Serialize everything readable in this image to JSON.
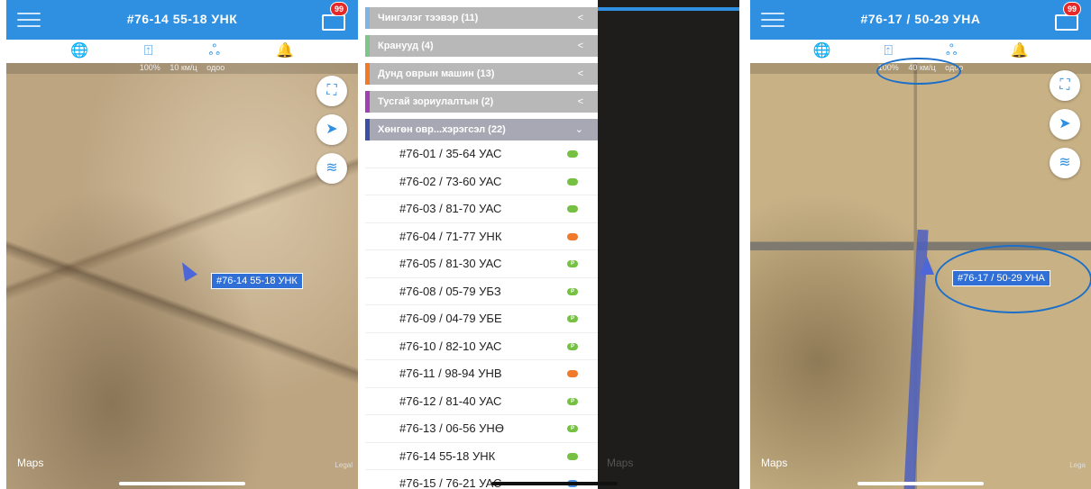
{
  "colors": {
    "accent": "#2f8fe0",
    "status_green": "#76c043",
    "status_orange": "#f07a2a",
    "status_blue": "#4a90e2",
    "status_parked": "#76c043"
  },
  "screen1": {
    "title": "#76-14 55-18 УНК",
    "badge": "99",
    "info": {
      "battery": "100%",
      "speed": "10 км/ц",
      "time": "одоо"
    },
    "vehicle_label": "#76-14 55-18 УНК",
    "maps_text": "Maps",
    "legal_text": "Legal"
  },
  "screen2": {
    "categories": [
      {
        "label": "Чингэлэг тээвэр (11)",
        "color": "#7fb5e6",
        "chevron": "<"
      },
      {
        "label": "Кранууд (4)",
        "color": "#7ec58a",
        "chevron": "<"
      },
      {
        "label": "Дунд оврын машин (13)",
        "color": "#f07a2a",
        "chevron": "<"
      },
      {
        "label": "Тусгай зориулалтын (2)",
        "color": "#a23fb4",
        "chevron": "<"
      }
    ],
    "open_category": {
      "label": "Хөнгөн овр...хэрэгсэл (22)",
      "color": "#3b4fa6",
      "chevron": "⌄"
    },
    "vehicles": [
      {
        "name": "#76-01 / 35-64 УАС",
        "status": "green"
      },
      {
        "name": "#76-02 / 73-60 УАС",
        "status": "green"
      },
      {
        "name": "#76-03 / 81-70 УАС",
        "status": "green"
      },
      {
        "name": "#76-04 / 71-77 УНК",
        "status": "orange"
      },
      {
        "name": "#76-05 / 81-30 УАС",
        "status": "parked"
      },
      {
        "name": "#76-08 / 05-79 УБЗ",
        "status": "parked"
      },
      {
        "name": "#76-09 / 04-79 УБЕ",
        "status": "parked"
      },
      {
        "name": "#76-10 / 82-10 УАС",
        "status": "parked"
      },
      {
        "name": "#76-11 / 98-94 УНВ",
        "status": "orange"
      },
      {
        "name": "#76-12 / 81-40 УАС",
        "status": "parked"
      },
      {
        "name": "#76-13 / 06-56 УНӨ",
        "status": "parked"
      },
      {
        "name": "#76-14 55-18 УНК",
        "status": "green"
      },
      {
        "name": "#76-15 / 76-21 УАС",
        "status": "blue"
      }
    ],
    "maps_text": "Maps"
  },
  "screen3": {
    "title": "#76-17 / 50-29 УНА",
    "badge": "99",
    "info": {
      "battery": "100%",
      "speed": "40 км/ц",
      "time": "одоо"
    },
    "vehicle_label": "#76-17 / 50-29 УНА",
    "maps_text": "Maps",
    "legal_text": "Lega"
  }
}
